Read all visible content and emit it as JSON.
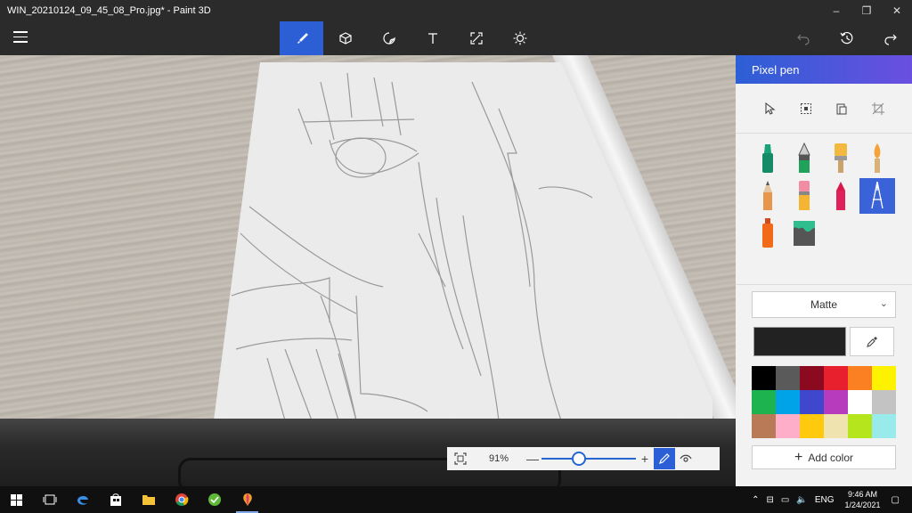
{
  "window": {
    "title": "WIN_20210124_09_45_08_Pro.jpg* - Paint 3D",
    "minimize": "–",
    "maximize": "❐",
    "close": "✕"
  },
  "toolbar": {
    "tools": [
      "brushes-icon",
      "3d-shapes-icon",
      "stickers-icon",
      "text-icon",
      "canvas-icon",
      "effects-icon"
    ],
    "active_tool": "brushes-icon",
    "right": [
      "undo-icon",
      "history-icon",
      "redo-icon"
    ]
  },
  "panel": {
    "title": "Pixel pen",
    "finish": "Matte",
    "current_color": "#222222",
    "palette": [
      "#000000",
      "#5a5a5a",
      "#8b0a1f",
      "#e8202e",
      "#fb8022",
      "#fff200",
      "#1db34e",
      "#00a2e8",
      "#3f48cc",
      "#b73bbd",
      "#ffffff",
      "#c3c3c3",
      "#b97a57",
      "#ffaec9",
      "#ffc90e",
      "#efe4b0",
      "#b5e61d",
      "#99eaea"
    ],
    "add_color": "Add color"
  },
  "zoom": {
    "percent": "91%",
    "minus": "—",
    "plus": "+",
    "level": 0.38
  },
  "taskbar": {
    "language": "ENG",
    "time": "9:46 AM",
    "date": "1/24/2021"
  }
}
